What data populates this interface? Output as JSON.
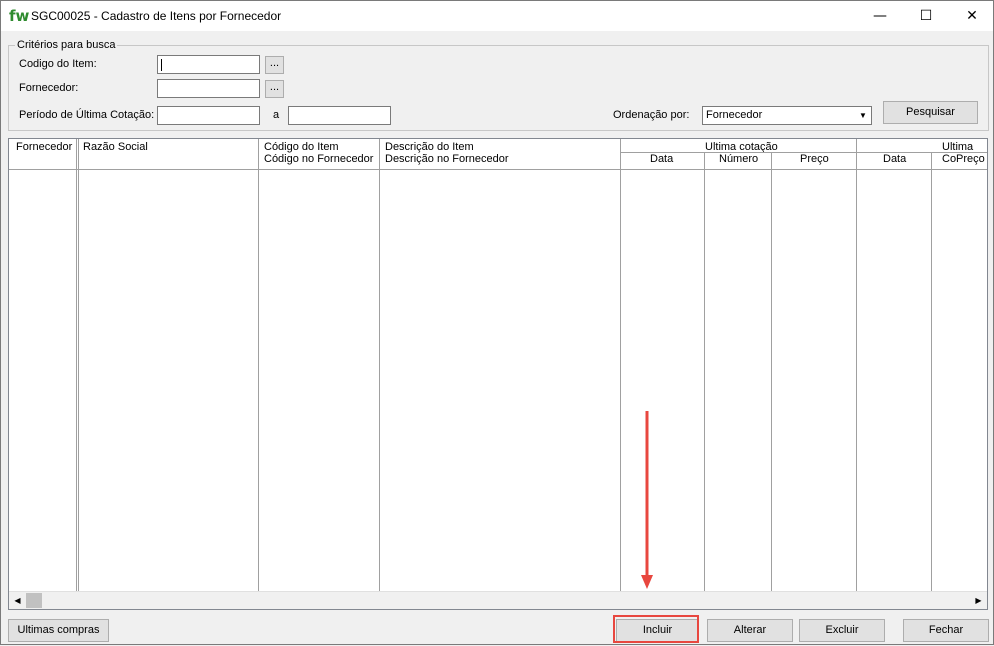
{
  "window": {
    "logo": "fw",
    "title": "SGC00025 - Cadastro de Itens por Fornecedor",
    "minimize_icon": "—",
    "maximize_icon": "☐",
    "close_icon": "✕"
  },
  "search": {
    "legend": "Critérios para busca",
    "item_code_label": "Codigo do Item:",
    "supplier_label": "Fornecedor:",
    "period_label": "Período de Última Cotação:",
    "period_separator": "a",
    "lookup_button": "...",
    "order_label": "Ordenação por:",
    "order_value": "Fornecedor",
    "search_button": "Pesquisar"
  },
  "grid": {
    "columns": {
      "fornecedor": "Fornecedor",
      "razao_social": "Razão Social",
      "codigo_item": "Código do Item",
      "codigo_fornecedor": "Código no Fornecedor",
      "descricao_item": "Descrição do Item",
      "descricao_fornecedor": "Descrição no Fornecedor",
      "ultima_cotacao": "Ultima cotação",
      "data": "Data",
      "numero": "Número",
      "preco": "Preço",
      "ultima_compra_partial": "Ultima Co",
      "data2": "Data",
      "preco2_partial": "Preço"
    },
    "rows": []
  },
  "buttons": {
    "ultimas_compras": "Ultimas compras",
    "incluir": "Incluir",
    "alterar": "Alterar",
    "excluir": "Excluir",
    "fechar": "Fechar"
  },
  "colors": {
    "annotation": "#e8473f",
    "logo": "#2e8b2e"
  }
}
